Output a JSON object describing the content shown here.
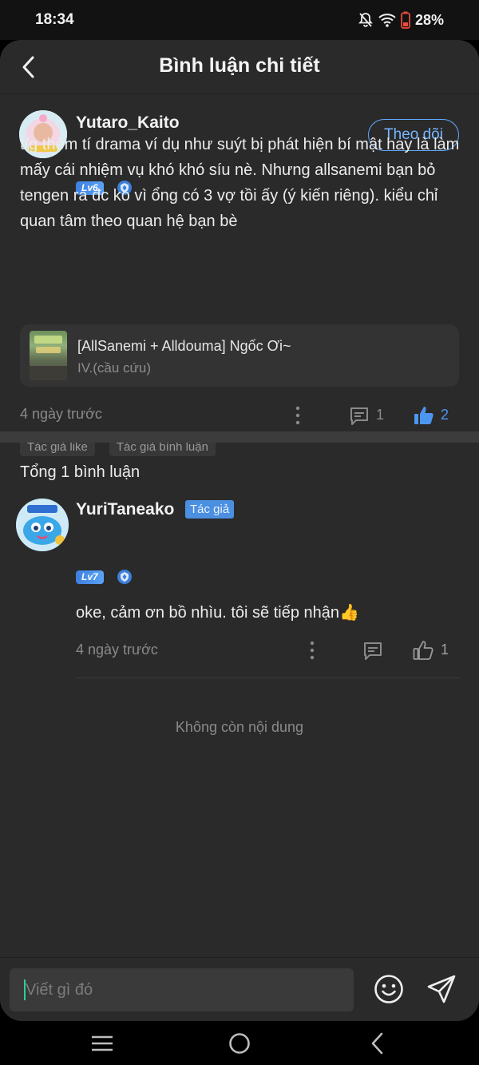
{
  "status_bar": {
    "time": "18:34",
    "battery": "28%"
  },
  "header": {
    "title": "Bình luận chi tiết"
  },
  "post": {
    "username": "Yutaro_Kaito",
    "level": "Lv6",
    "follow_label": "Theo dõi",
    "text": "t/g thêm tí drama ví dụ như suýt bị phát hiện bí mật hay là làm mấy cái nhiệm vụ khó khó síu nè. Nhưng allsanemi bạn bỏ tengen ra đc ko vì ổng có 3 vợ tồi ấy (ý kiến riêng). kiểu chỉ quan tâm theo quan hệ bạn bè",
    "book": {
      "title": "[AllSanemi + Alldouma] Ngốc Ơi~",
      "chapter": "IV.(cầu cứu)"
    },
    "time": "4 ngày trước",
    "comment_count": "1",
    "like_count": "2",
    "tags": [
      "Tác giả like",
      "Tác giả bình luận"
    ]
  },
  "comments": {
    "total_label": "Tổng 1 bình luận",
    "items": [
      {
        "username": "YuriTaneako",
        "author_badge": "Tác giả",
        "level": "Lv7",
        "text": "oke, cảm ơn bồ nhìu. tôi sẽ tiếp nhận👍",
        "time": "4 ngày trước",
        "like_count": "1"
      }
    ],
    "end_label": "Không còn nội dung"
  },
  "input": {
    "placeholder": "Viết gì đó"
  },
  "colors": {
    "accent": "#5fa9ff",
    "like_active": "#4d96f0",
    "background": "#2a2a2a"
  },
  "icons": [
    "back-arrow-icon",
    "comment-icon",
    "thumbs-up-icon",
    "more-vertical-icon",
    "emoji-icon",
    "send-icon",
    "shield-icon"
  ]
}
